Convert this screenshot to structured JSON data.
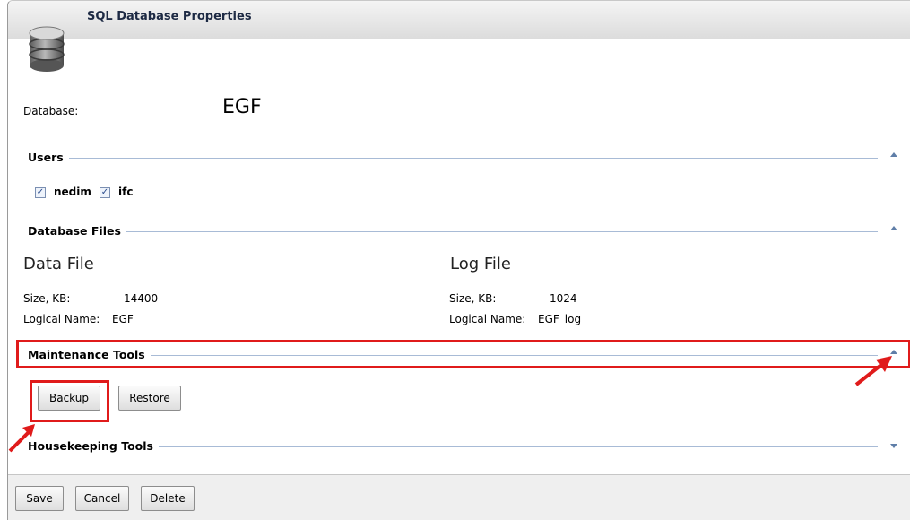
{
  "window": {
    "title": "SQL Database Properties"
  },
  "database": {
    "label": "Database:",
    "value": "EGF"
  },
  "users": {
    "section_title": "Users",
    "items": [
      {
        "label": "nedim",
        "checked": true
      },
      {
        "label": "ifc",
        "checked": true
      }
    ]
  },
  "files": {
    "section_title": "Database Files",
    "data": {
      "heading": "Data File",
      "size_label": "Size, KB:",
      "size_value": "14400",
      "logical_label": "Logical Name:",
      "logical_value": "EGF"
    },
    "log": {
      "heading": "Log File",
      "size_label": "Size, KB:",
      "size_value": "1024",
      "logical_label": "Logical Name:",
      "logical_value": "EGF_log"
    }
  },
  "maintenance": {
    "section_title": "Maintenance Tools",
    "backup_label": "Backup",
    "restore_label": "Restore"
  },
  "housekeeping": {
    "section_title": "Housekeeping Tools"
  },
  "footer": {
    "save_label": "Save",
    "cancel_label": "Cancel",
    "delete_label": "Delete"
  },
  "icons": {
    "database": "database-icon",
    "collapse": "triangle-up-icon",
    "expand": "triangle-down-icon",
    "check": "checkmark-icon"
  },
  "colors": {
    "highlight": "#e01b1b",
    "section_line": "#a8bbd6",
    "title_text": "#1d2a44"
  }
}
